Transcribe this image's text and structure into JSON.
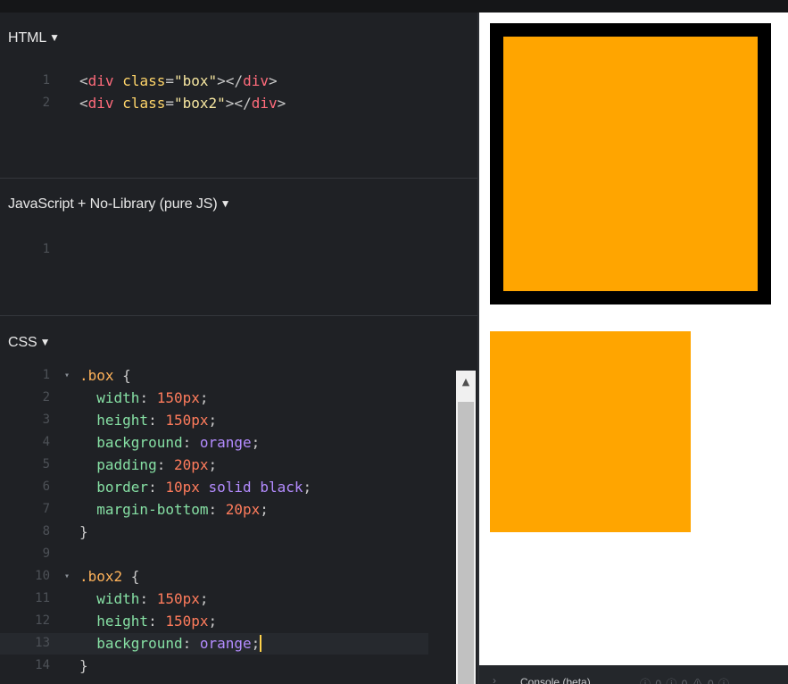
{
  "html_panel": {
    "title": "HTML",
    "lines": [
      {
        "n": "1",
        "tokens": [
          [
            "punc",
            "<"
          ],
          [
            "tag",
            "div"
          ],
          [
            "punc",
            " "
          ],
          [
            "attr",
            "class"
          ],
          [
            "punc",
            "="
          ],
          [
            "str",
            "\"box\""
          ],
          [
            "punc",
            "></"
          ],
          [
            "tag",
            "div"
          ],
          [
            "punc",
            ">"
          ]
        ]
      },
      {
        "n": "2",
        "tokens": [
          [
            "punc",
            "<"
          ],
          [
            "tag",
            "div"
          ],
          [
            "punc",
            " "
          ],
          [
            "attr",
            "class"
          ],
          [
            "punc",
            "="
          ],
          [
            "str",
            "\"box2\""
          ],
          [
            "punc",
            "></"
          ],
          [
            "tag",
            "div"
          ],
          [
            "punc",
            ">"
          ]
        ]
      }
    ]
  },
  "js_panel": {
    "title": "JavaScript + No-Library (pure JS)",
    "lines": [
      {
        "n": "1",
        "tokens": []
      }
    ]
  },
  "css_panel": {
    "title": "CSS",
    "current_line": "13",
    "lines": [
      {
        "n": "1",
        "fold": true,
        "tokens": [
          [
            "sel",
            ".box"
          ],
          [
            "punc",
            " {"
          ]
        ]
      },
      {
        "n": "2",
        "tokens": [
          [
            "punc",
            "  "
          ],
          [
            "prop",
            "width"
          ],
          [
            "punc",
            ": "
          ],
          [
            "num",
            "150px"
          ],
          [
            "punc",
            ";"
          ]
        ]
      },
      {
        "n": "3",
        "tokens": [
          [
            "punc",
            "  "
          ],
          [
            "prop",
            "height"
          ],
          [
            "punc",
            ": "
          ],
          [
            "num",
            "150px"
          ],
          [
            "punc",
            ";"
          ]
        ]
      },
      {
        "n": "4",
        "tokens": [
          [
            "punc",
            "  "
          ],
          [
            "prop",
            "background"
          ],
          [
            "punc",
            ": "
          ],
          [
            "kw",
            "orange"
          ],
          [
            "punc",
            ";"
          ]
        ]
      },
      {
        "n": "5",
        "tokens": [
          [
            "punc",
            "  "
          ],
          [
            "prop",
            "padding"
          ],
          [
            "punc",
            ": "
          ],
          [
            "num",
            "20px"
          ],
          [
            "punc",
            ";"
          ]
        ]
      },
      {
        "n": "6",
        "tokens": [
          [
            "punc",
            "  "
          ],
          [
            "prop",
            "border"
          ],
          [
            "punc",
            ": "
          ],
          [
            "num",
            "10px"
          ],
          [
            "punc",
            " "
          ],
          [
            "kw",
            "solid"
          ],
          [
            "punc",
            " "
          ],
          [
            "kw",
            "black"
          ],
          [
            "punc",
            ";"
          ]
        ]
      },
      {
        "n": "7",
        "tokens": [
          [
            "punc",
            "  "
          ],
          [
            "prop",
            "margin-bottom"
          ],
          [
            "punc",
            ": "
          ],
          [
            "num",
            "20px"
          ],
          [
            "punc",
            ";"
          ]
        ]
      },
      {
        "n": "8",
        "tokens": [
          [
            "punc",
            "}"
          ]
        ]
      },
      {
        "n": "9",
        "tokens": []
      },
      {
        "n": "10",
        "fold": true,
        "tokens": [
          [
            "sel",
            ".box2"
          ],
          [
            "punc",
            " {"
          ]
        ]
      },
      {
        "n": "11",
        "tokens": [
          [
            "punc",
            "  "
          ],
          [
            "prop",
            "width"
          ],
          [
            "punc",
            ": "
          ],
          [
            "num",
            "150px"
          ],
          [
            "punc",
            ";"
          ]
        ]
      },
      {
        "n": "12",
        "tokens": [
          [
            "punc",
            "  "
          ],
          [
            "prop",
            "height"
          ],
          [
            "punc",
            ": "
          ],
          [
            "num",
            "150px"
          ],
          [
            "punc",
            ";"
          ]
        ]
      },
      {
        "n": "13",
        "cursor": true,
        "tokens": [
          [
            "punc",
            "  "
          ],
          [
            "prop",
            "background"
          ],
          [
            "punc",
            ": "
          ],
          [
            "kw",
            "orange"
          ],
          [
            "punc",
            ";"
          ]
        ]
      },
      {
        "n": "14",
        "tokens": [
          [
            "punc",
            "}"
          ]
        ]
      }
    ]
  },
  "panel_toggle_glyph": "▼",
  "fold_glyph": "▾",
  "scroll_up_glyph": "▲",
  "preview": {
    "box_color": "#ffa500",
    "border_color": "#000000"
  },
  "console": {
    "chevron": "›",
    "label": "Console (beta)",
    "counts": "ⓘ 0  ⓘ 0  ⚠ 0  ⓘ"
  }
}
